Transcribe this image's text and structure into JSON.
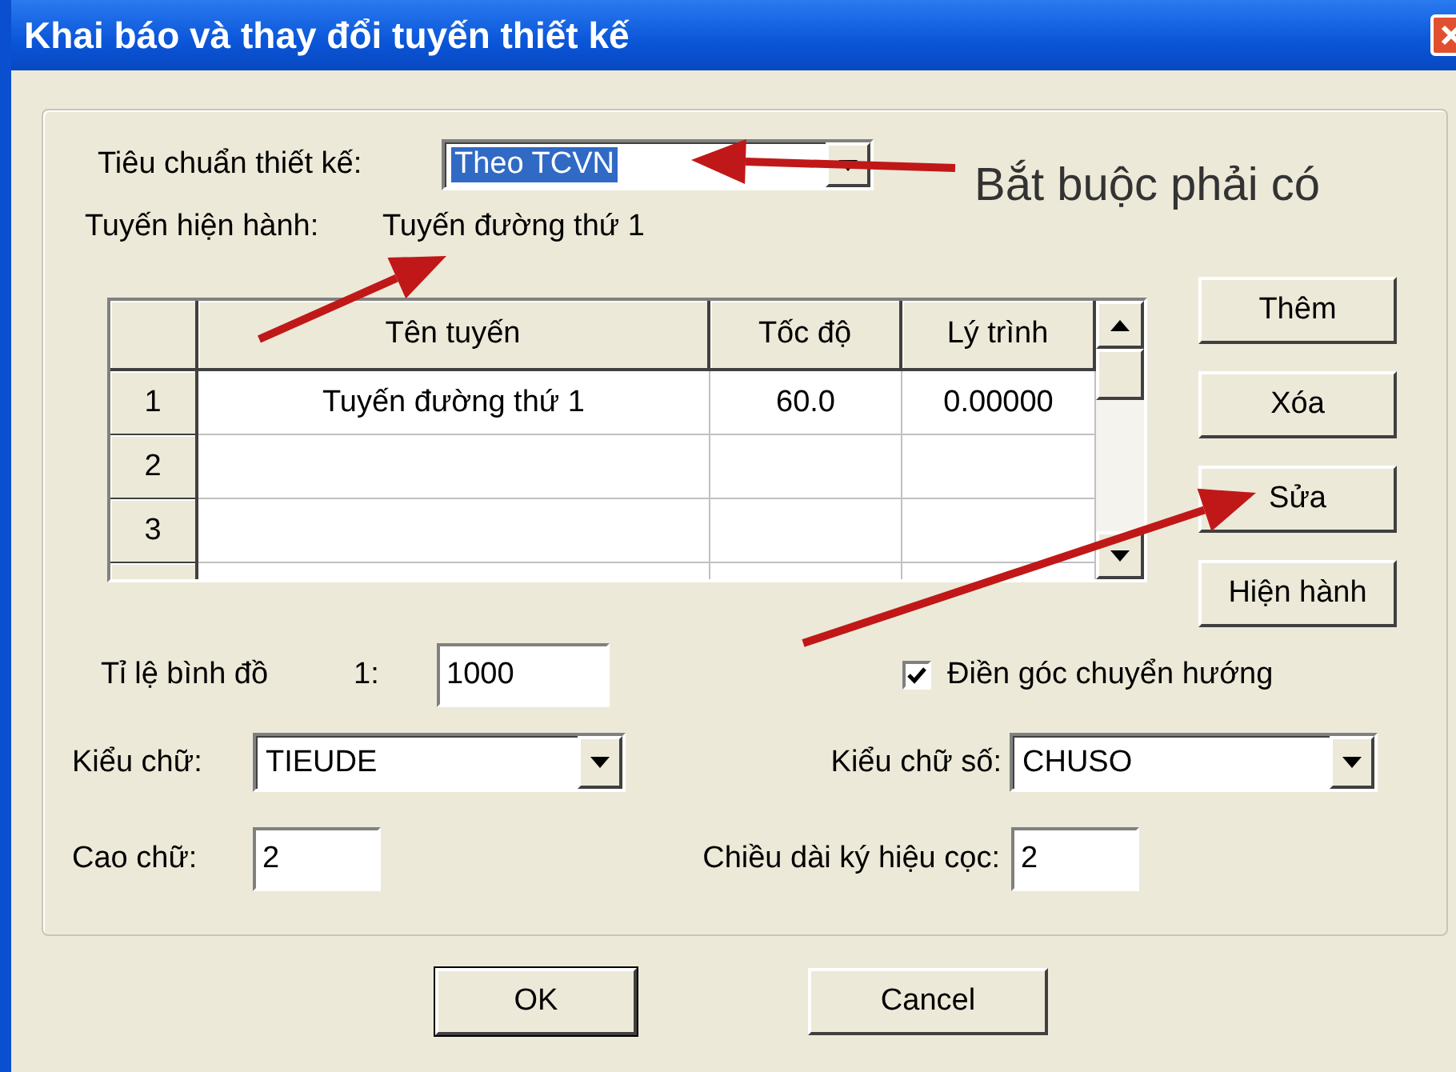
{
  "window": {
    "title": "Khai báo và thay đổi tuyến thiết kế"
  },
  "design_standard": {
    "label": "Tiêu chuẩn thiết kế:",
    "value": "Theo TCVN",
    "selected": true
  },
  "current_route": {
    "label": "Tuyến hiện hành:",
    "value": "Tuyến đường thứ  1"
  },
  "table": {
    "columns": [
      "Tên tuyến",
      "Tốc độ",
      "Lý trình"
    ],
    "rows": [
      {
        "number": "1",
        "cells": [
          "Tuyến đường thứ  1",
          "60.0",
          "0.00000"
        ]
      },
      {
        "number": "2"
      },
      {
        "number": "3"
      }
    ]
  },
  "side_buttons": [
    "Thêm",
    "Xóa",
    "Sửa",
    "Hiện hành"
  ],
  "scale": {
    "label": "Tỉ lệ bình đồ",
    "prefix": "1:",
    "value": "1000"
  },
  "checkbox": {
    "label": "Điền góc chuyển hướng",
    "checked": true
  },
  "font_style": {
    "label": "Kiểu chữ:",
    "value": "TIEUDE"
  },
  "number_font_style": {
    "label": "Kiểu chữ số:",
    "value": "CHUSO"
  },
  "text_height": {
    "label": "Cao chữ:",
    "value": "2"
  },
  "stake_length": {
    "label": "Chiều dài ký hiệu cọc:",
    "value": "2"
  },
  "buttons": [
    "OK",
    "Cancel"
  ],
  "annotation": {
    "text": "Bắt buộc phải có"
  }
}
